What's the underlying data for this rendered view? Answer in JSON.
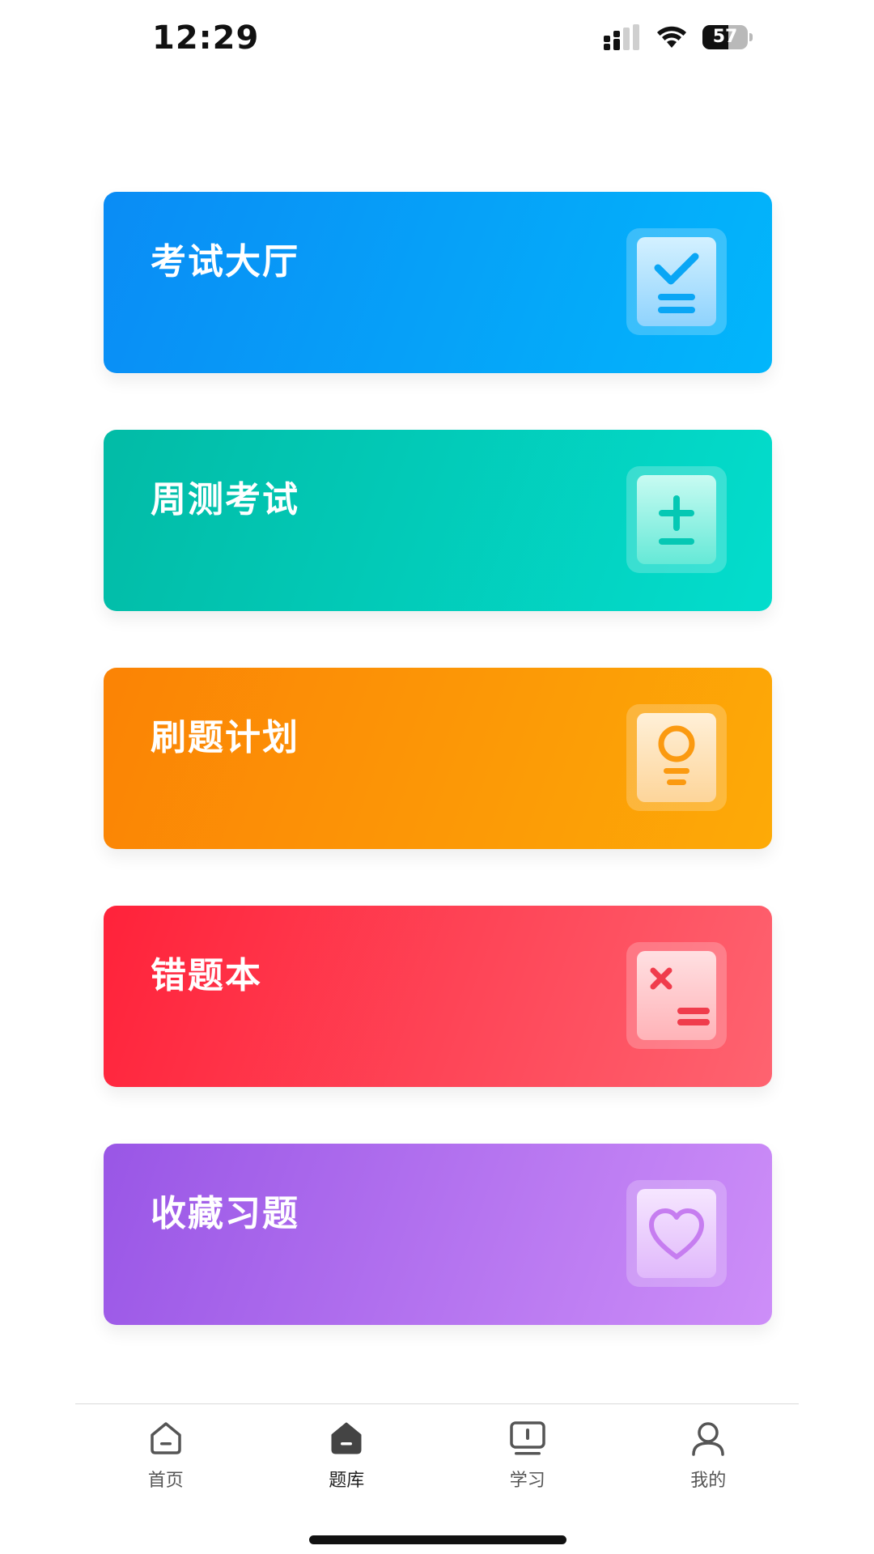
{
  "status_bar": {
    "time": "12:29",
    "battery_level": "57",
    "battery_fraction": 0.57,
    "icons": [
      "signal-icon",
      "wifi-icon",
      "battery-icon"
    ]
  },
  "cards": [
    {
      "title": "考试大厅",
      "icon": "checklist-icon",
      "gradient": [
        "#0a8cf5",
        "#02b6fb"
      ],
      "accent": "#0aa6f5"
    },
    {
      "title": "周测考试",
      "icon": "plus-minus-icon",
      "gradient": [
        "#02bba6",
        "#03ddcd"
      ],
      "accent": "#05c8b4"
    },
    {
      "title": "刷题计划",
      "icon": "lightbulb-icon",
      "gradient": [
        "#fb8305",
        "#fdaa07"
      ],
      "accent": "#fb9a10"
    },
    {
      "title": "错题本",
      "icon": "wrong-answer-icon",
      "gradient": [
        "#ff223a",
        "#fe6370"
      ],
      "accent": "#f03c4c"
    },
    {
      "title": "收藏习题",
      "icon": "heart-icon",
      "gradient": [
        "#9956e6",
        "#cd8ef8"
      ],
      "accent": "#c67df0"
    }
  ],
  "tab_bar": {
    "items": [
      {
        "label": "首页",
        "icon": "home-icon",
        "active": false
      },
      {
        "label": "题库",
        "icon": "question-bank-icon",
        "active": true
      },
      {
        "label": "学习",
        "icon": "study-icon",
        "active": false
      },
      {
        "label": "我的",
        "icon": "profile-icon",
        "active": false
      }
    ]
  }
}
